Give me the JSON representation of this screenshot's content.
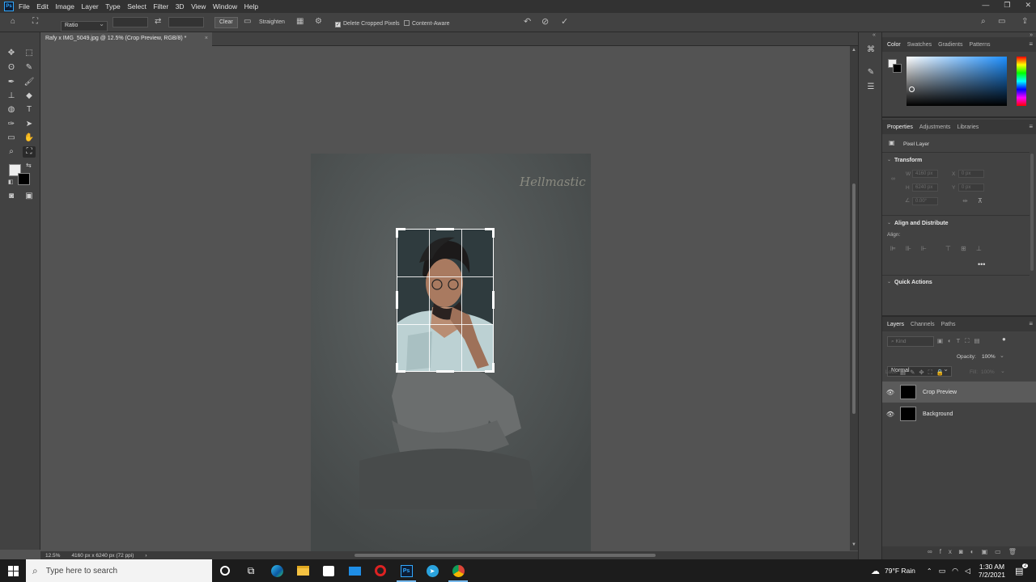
{
  "menubar": {
    "logo": "Ps",
    "items": [
      "File",
      "Edit",
      "Image",
      "Layer",
      "Type",
      "Select",
      "Filter",
      "3D",
      "View",
      "Window",
      "Help"
    ]
  },
  "options": {
    "ratio_value": "Ratio",
    "clear_label": "Clear",
    "straighten_label": "Straighten",
    "delete_cropped_label": "Delete Cropped Pixels",
    "content_aware_label": "Content-Aware"
  },
  "document": {
    "tab_title": "Rafy x IMG_5049.jpg @ 12.5% (Crop Preview, RGB/8) *",
    "signature": "Hellmastic"
  },
  "status": {
    "zoom": "12.5%",
    "dimensions": "4160 px x 6240 px (72 ppi)"
  },
  "color_panel": {
    "tabs": [
      "Color",
      "Swatches",
      "Gradients",
      "Patterns"
    ],
    "active_tab": "Color"
  },
  "properties_panel": {
    "tabs": [
      "Properties",
      "Adjustments",
      "Libraries"
    ],
    "layer_type": "Pixel Layer",
    "transform_title": "Transform",
    "w_label": "W",
    "w_value": "4160 px",
    "x_label": "X",
    "x_value": "0 px",
    "h_label": "H",
    "h_value": "6240 px",
    "y_label": "Y",
    "y_value": "0 px",
    "angle_value": "0.00°",
    "align_title": "Align and Distribute",
    "align_label": "Align:",
    "quick_actions_title": "Quick Actions"
  },
  "layers_panel": {
    "tabs": [
      "Layers",
      "Channels",
      "Paths"
    ],
    "filter_placeholder": "Kind",
    "blend_mode": "Normal",
    "opacity_label": "Opacity:",
    "opacity_value": "100%",
    "lock_label": "Lock:",
    "fill_label": "Fill:",
    "fill_value": "100%",
    "layers": [
      {
        "name": "Crop Preview",
        "selected": true
      },
      {
        "name": "Background",
        "selected": false
      }
    ]
  },
  "taskbar": {
    "search_placeholder": "Type here to search",
    "weather": "79°F  Rain",
    "time": "1:30 AM",
    "date": "7/2/2021",
    "notification_count": "2"
  }
}
